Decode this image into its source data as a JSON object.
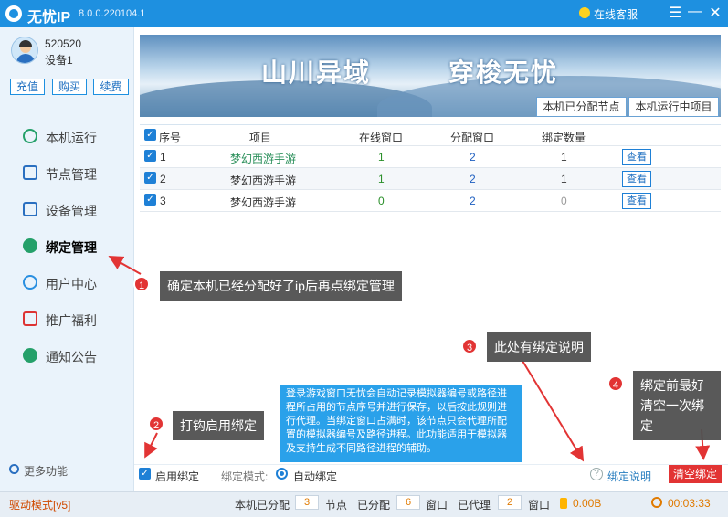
{
  "window": {
    "app_name": "无忧IP",
    "version": "8.0.0.220104.1",
    "support_label": "在线客服",
    "menu_symbol": "☰",
    "minimize_symbol": "—",
    "close_symbol": "✕"
  },
  "account": {
    "user_id": "520520",
    "device": "设备1",
    "buttons": [
      "充值",
      "购买",
      "续费"
    ]
  },
  "sidebar": {
    "items": [
      {
        "label": "本机运行",
        "icon": "play-icon"
      },
      {
        "label": "节点管理",
        "icon": "node-icon"
      },
      {
        "label": "设备管理",
        "icon": "device-icon"
      },
      {
        "label": "绑定管理",
        "icon": "bind-icon",
        "active": true
      },
      {
        "label": "用户中心",
        "icon": "user-icon"
      },
      {
        "label": "推广福利",
        "icon": "gift-icon"
      },
      {
        "label": "通知公告",
        "icon": "bell-icon"
      }
    ],
    "more_label": "更多功能"
  },
  "banner": {
    "text_left": "山川异域",
    "text_right": "穿梭无忧",
    "tabs": [
      "本机已分配节点",
      "本机运行中项目"
    ]
  },
  "table": {
    "headers": [
      "序号",
      "项目",
      "在线窗口",
      "分配窗口",
      "绑定数量"
    ],
    "rows": [
      {
        "no": "1",
        "project": "梦幻西游手游",
        "online": "1",
        "assigned": "2",
        "bound": "1",
        "action": "查看"
      },
      {
        "no": "2",
        "project": "梦幻西游手游",
        "online": "1",
        "assigned": "2",
        "bound": "1",
        "action": "查看"
      },
      {
        "no": "3",
        "project": "梦幻西游手游",
        "online": "0",
        "assigned": "2",
        "bound": "0",
        "action": "查看"
      }
    ]
  },
  "callouts": {
    "c1": {
      "num": "1",
      "text": "确定本机已经分配好了ip后再点绑定管理"
    },
    "c2": {
      "num": "2",
      "text": "打钩启用绑定"
    },
    "c3": {
      "num": "3",
      "text": "此处有绑定说明"
    },
    "c4": {
      "num": "4",
      "text": "绑定前最好清空一次绑定"
    }
  },
  "note": "登录游戏窗口无忧会自动记录模拟器编号或路径进程所占用的节点序号并进行保存，以后按此规则进行代理。当绑定窗口占满时，该节点只会代理所配置的模拟器编号及路径进程。此功能适用于模拟器及支持生成不同路径进程的辅助。",
  "bottom": {
    "enable_bind": "启用绑定",
    "mode_label": "绑定模式:",
    "auto_bind": "自动绑定",
    "help": "绑定说明",
    "clear": "清空绑定"
  },
  "status": {
    "driver_mode": "驱动模式[v5]",
    "label_assigned": "本机已分配",
    "nodes": "3",
    "label_nodes": "节点",
    "label_alloc": "已分配",
    "windows_assigned": "6",
    "label_window": "窗口",
    "label_proxied": "已代理",
    "windows_proxied": "2",
    "label_window2": "窗口",
    "traffic": "0.00B",
    "time": "00:03:33"
  },
  "colors": {
    "accent": "#1e90e0",
    "danger": "#e23434",
    "callout": "#505050"
  }
}
